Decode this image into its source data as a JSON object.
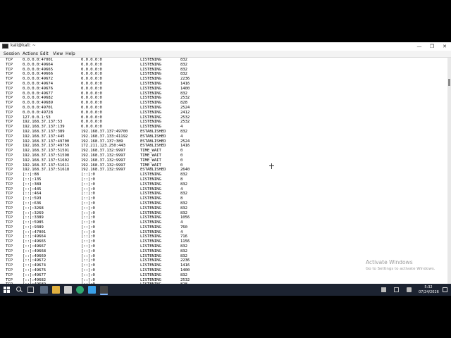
{
  "window": {
    "title": "kali@kali: ~",
    "minimize": "—",
    "maximize": "❐",
    "close": "✕"
  },
  "menu": [
    "Session",
    "Actions",
    "Edit",
    "View",
    "Help"
  ],
  "rows": [
    [
      "TCP",
      "0.0.0.0:47001",
      "0.0.0.0:0",
      "LISTENING",
      "832"
    ],
    [
      "TCP",
      "0.0.0.0:49664",
      "0.0.0.0:0",
      "LISTENING",
      "832"
    ],
    [
      "TCP",
      "0.0.0.0:49665",
      "0.0.0.0:0",
      "LISTENING",
      "832"
    ],
    [
      "TCP",
      "0.0.0.0:49666",
      "0.0.0.0:0",
      "LISTENING",
      "832"
    ],
    [
      "TCP",
      "0.0.0.0:49672",
      "0.0.0.0:0",
      "LISTENING",
      "2236"
    ],
    [
      "TCP",
      "0.0.0.0:49674",
      "0.0.0.0:0",
      "LISTENING",
      "1416"
    ],
    [
      "TCP",
      "0.0.0.0:49676",
      "0.0.0.0:0",
      "LISTENING",
      "1400"
    ],
    [
      "TCP",
      "0.0.0.0:49677",
      "0.0.0.0:0",
      "LISTENING",
      "832"
    ],
    [
      "TCP",
      "0.0.0.0:49682",
      "0.0.0.0:0",
      "LISTENING",
      "2532"
    ],
    [
      "TCP",
      "0.0.0.0:49689",
      "0.0.0.0:0",
      "LISTENING",
      "828"
    ],
    [
      "TCP",
      "0.0.0.0:49701",
      "0.0.0.0:0",
      "LISTENING",
      "2524"
    ],
    [
      "TCP",
      "0.0.0.0:49728",
      "0.0.0.0:0",
      "LISTENING",
      "2412"
    ],
    [
      "TCP",
      "127.0.0.1:53",
      "0.0.0.0:0",
      "LISTENING",
      "2532"
    ],
    [
      "TCP",
      "192.168.37.137:53",
      "0.0.0.0:0",
      "LISTENING",
      "2532"
    ],
    [
      "TCP",
      "192.168.37.137:139",
      "0.0.0.0:0",
      "LISTENING",
      "4"
    ],
    [
      "TCP",
      "192.168.37.137:389",
      "192.168.37.137:49700",
      "ESTABLISHED",
      "832"
    ],
    [
      "TCP",
      "192.168.37.137:445",
      "192.168.37.133:41192",
      "ESTABLISHED",
      "4"
    ],
    [
      "TCP",
      "192.168.37.137:49700",
      "192.168.37.137:389",
      "ESTABLISHED",
      "2524"
    ],
    [
      "TCP",
      "192.168.37.137:49759",
      "172.211.123.250:443",
      "ESTABLISHED",
      "1416"
    ],
    [
      "TCP",
      "192.168.37.137:51591",
      "192.168.37.132:9997",
      "TIME_WAIT",
      "0"
    ],
    [
      "TCP",
      "192.168.37.137:51598",
      "192.168.37.132:9997",
      "TIME_WAIT",
      "0"
    ],
    [
      "TCP",
      "192.168.37.137:51602",
      "192.168.37.132:9997",
      "TIME_WAIT",
      "0"
    ],
    [
      "TCP",
      "192.168.37.137:51611",
      "192.168.37.132:9997",
      "TIME_WAIT",
      "0"
    ],
    [
      "TCP",
      "192.168.37.137:51618",
      "192.168.37.132:9997",
      "ESTABLISHED",
      "2640"
    ],
    [
      "TCP",
      "[::]:88",
      "[::]:0",
      "LISTENING",
      "832"
    ],
    [
      "TCP",
      "[::]:135",
      "[::]:0",
      "LISTENING",
      "8"
    ],
    [
      "TCP",
      "[::]:389",
      "[::]:0",
      "LISTENING",
      "832"
    ],
    [
      "TCP",
      "[::]:445",
      "[::]:0",
      "LISTENING",
      "4"
    ],
    [
      "TCP",
      "[::]:464",
      "[::]:0",
      "LISTENING",
      "832"
    ],
    [
      "TCP",
      "[::]:593",
      "[::]:0",
      "LISTENING",
      "8"
    ],
    [
      "TCP",
      "[::]:636",
      "[::]:0",
      "LISTENING",
      "832"
    ],
    [
      "TCP",
      "[::]:3268",
      "[::]:0",
      "LISTENING",
      "832"
    ],
    [
      "TCP",
      "[::]:3269",
      "[::]:0",
      "LISTENING",
      "832"
    ],
    [
      "TCP",
      "[::]:3389",
      "[::]:0",
      "LISTENING",
      "1056"
    ],
    [
      "TCP",
      "[::]:5985",
      "[::]:0",
      "LISTENING",
      "4"
    ],
    [
      "TCP",
      "[::]:9389",
      "[::]:0",
      "LISTENING",
      "760"
    ],
    [
      "TCP",
      "[::]:47001",
      "[::]:0",
      "LISTENING",
      "4"
    ],
    [
      "TCP",
      "[::]:49664",
      "[::]:0",
      "LISTENING",
      "716"
    ],
    [
      "TCP",
      "[::]:49665",
      "[::]:0",
      "LISTENING",
      "1156"
    ],
    [
      "TCP",
      "[::]:49667",
      "[::]:0",
      "LISTENING",
      "832"
    ],
    [
      "TCP",
      "[::]:49668",
      "[::]:0",
      "LISTENING",
      "832"
    ],
    [
      "TCP",
      "[::]:49669",
      "[::]:0",
      "LISTENING",
      "832"
    ],
    [
      "TCP",
      "[::]:49672",
      "[::]:0",
      "LISTENING",
      "2236"
    ],
    [
      "TCP",
      "[::]:49674",
      "[::]:0",
      "LISTENING",
      "1416"
    ],
    [
      "TCP",
      "[::]:49676",
      "[::]:0",
      "LISTENING",
      "1400"
    ],
    [
      "TCP",
      "[::]:49677",
      "[::]:0",
      "LISTENING",
      "832"
    ],
    [
      "TCP",
      "[::]:49682",
      "[::]:0",
      "LISTENING",
      "2532"
    ],
    [
      "TCP",
      "[::]:49689",
      "[::]:0",
      "LISTENING",
      "828"
    ]
  ],
  "watermark": {
    "title": "Activate Windows",
    "subtitle": "Go to Settings to activate Windows."
  },
  "taskbar": {
    "time": "5:32",
    "date": "07/24/2026",
    "apps": [
      "windows-start-icon",
      "search-icon",
      "task-view-icon",
      "file-explorer-icon",
      "folder-icon",
      "terminal-icon",
      "edge-browser-icon",
      "blue-app-icon",
      "command-prompt-icon"
    ],
    "accent": "#1c2331"
  }
}
